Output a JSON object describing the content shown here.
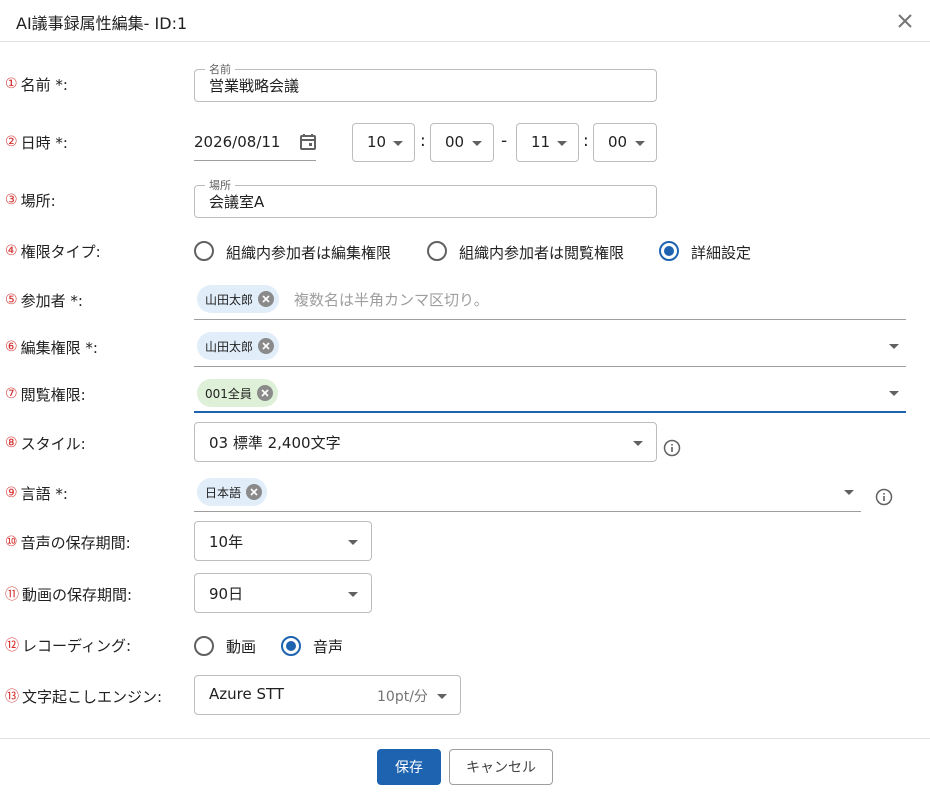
{
  "dialog": {
    "title": "AI議事録属性編集- ID:1"
  },
  "fields": {
    "name": {
      "num": "①",
      "label": "名前 *:",
      "float_label": "名前",
      "value": "営業戦略会議"
    },
    "datetime": {
      "num": "②",
      "label": "日時 *:",
      "date": "2026/08/11",
      "start_hour": "10",
      "start_min": "00",
      "end_hour": "11",
      "end_min": "00",
      "colon": ":",
      "dash": "-"
    },
    "place": {
      "num": "③",
      "label": "場所:",
      "float_label": "場所",
      "value": "会議室A"
    },
    "permission_type": {
      "num": "④",
      "label": "権限タイプ:",
      "options": [
        "組織内参加者は編集権限",
        "組織内参加者は閲覧権限",
        "詳細設定"
      ],
      "selected": "詳細設定"
    },
    "participants": {
      "num": "⑤",
      "label": "参加者 *:",
      "chips": [
        "山田太郎"
      ],
      "placeholder": "複数名は半角カンマ区切り。"
    },
    "edit_permission": {
      "num": "⑥",
      "label": "編集権限 *:",
      "chips": [
        "山田太郎"
      ]
    },
    "view_permission": {
      "num": "⑦",
      "label": "閲覧権限:",
      "chips": [
        "001全員"
      ]
    },
    "style": {
      "num": "⑧",
      "label": "スタイル:",
      "value": "03 標準 2,400文字"
    },
    "language": {
      "num": "⑨",
      "label": "言語 *:",
      "chips": [
        "日本語"
      ]
    },
    "audio_retention": {
      "num": "⑩",
      "label": "音声の保存期間:",
      "value": "10年"
    },
    "video_retention": {
      "num": "⑪",
      "label": "動画の保存期間:",
      "value": "90日"
    },
    "recording": {
      "num": "⑫",
      "label": "レコーディング:",
      "options": [
        "動画",
        "音声"
      ],
      "selected": "音声"
    },
    "engine": {
      "num": "⑬",
      "label": "文字起こしエンジン:",
      "value": "Azure STT",
      "rate": "10pt/分"
    }
  },
  "footer": {
    "save_label": "保存",
    "cancel_label": "キャンセル"
  },
  "colors": {
    "primary": "#1e63b0",
    "number": "#d32f2f",
    "chip_blue": "#e1edf9",
    "chip_green": "#dff0d8"
  },
  "icons": {
    "close": "close-icon",
    "calendar": "calendar-icon",
    "info": "info-icon",
    "chip_remove": "cancel-circle-icon",
    "dropdown": "caret-down-icon"
  }
}
